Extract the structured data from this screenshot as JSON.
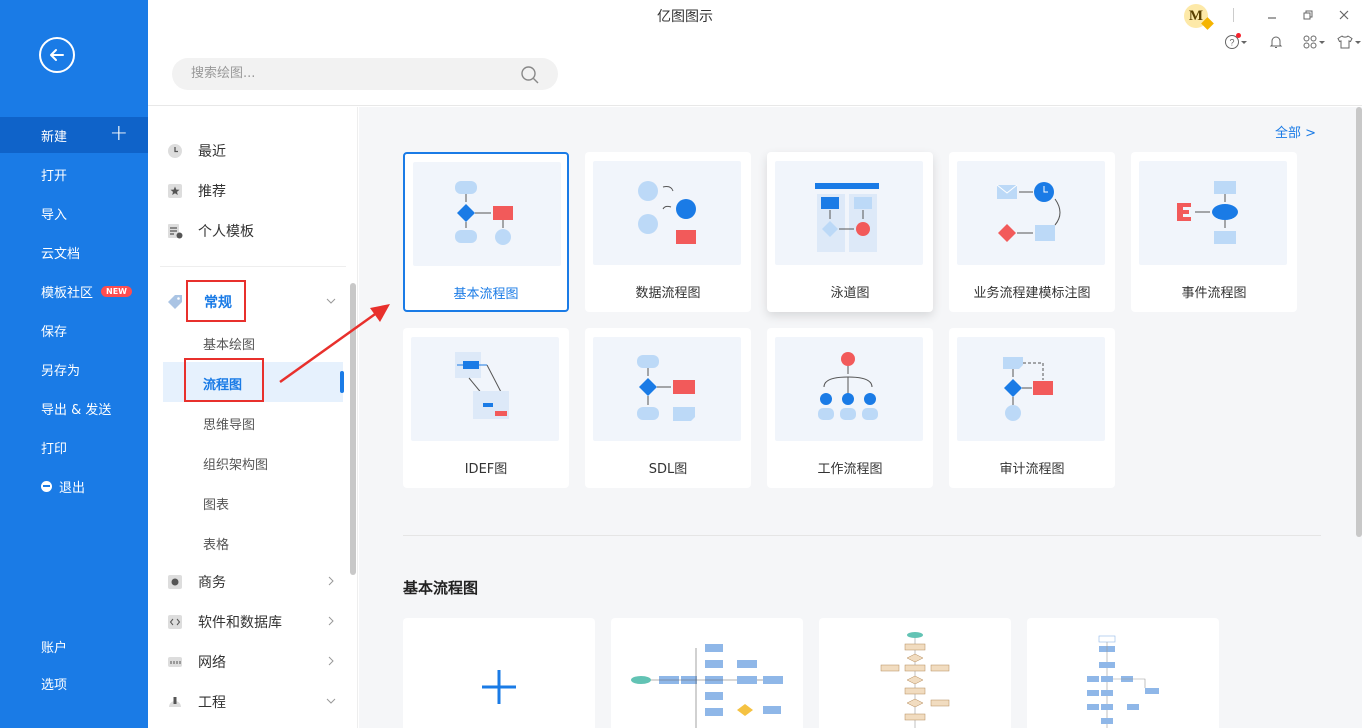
{
  "app": {
    "title": "亿图图示"
  },
  "leftnav": {
    "items": [
      {
        "label": "新建"
      },
      {
        "label": "打开"
      },
      {
        "label": "导入"
      },
      {
        "label": "云文档"
      },
      {
        "label": "模板社区",
        "badge": "NEW"
      },
      {
        "label": "保存"
      },
      {
        "label": "另存为"
      },
      {
        "label": "导出 & 发送"
      },
      {
        "label": "打印"
      },
      {
        "label": "退出"
      },
      {
        "label": "账户"
      },
      {
        "label": "选项"
      }
    ]
  },
  "header": {
    "search_placeholder": "搜索绘图...",
    "avatar_letter": "M"
  },
  "categories": {
    "top": [
      {
        "label": "最近",
        "icon": "clock-icon"
      },
      {
        "label": "推荐",
        "icon": "star-icon"
      },
      {
        "label": "个人模板",
        "icon": "template-icon"
      }
    ],
    "general": {
      "label": "常规",
      "icon": "tag-icon"
    },
    "general_subs": [
      {
        "label": "基本绘图"
      },
      {
        "label": "流程图"
      },
      {
        "label": "思维导图"
      },
      {
        "label": "组织架构图"
      },
      {
        "label": "图表"
      },
      {
        "label": "表格"
      }
    ],
    "others": [
      {
        "label": "商务",
        "icon": "business-icon"
      },
      {
        "label": "软件和数据库",
        "icon": "code-icon"
      },
      {
        "label": "网络",
        "icon": "network-icon"
      },
      {
        "label": "工程",
        "icon": "engineering-icon"
      }
    ]
  },
  "main": {
    "all_link": "全部  >",
    "cards": [
      {
        "label": "基本流程图"
      },
      {
        "label": "数据流程图"
      },
      {
        "label": "泳道图"
      },
      {
        "label": "业务流程建模标注图"
      },
      {
        "label": "事件流程图"
      },
      {
        "label": "IDEF图"
      },
      {
        "label": "SDL图"
      },
      {
        "label": "工作流程图"
      },
      {
        "label": "审计流程图"
      }
    ],
    "section_title": "基本流程图"
  },
  "colors": {
    "nav_blue": "#1a7be6",
    "accent_red": "#e8302c",
    "shape_blue": "#1a7be6",
    "shape_light": "#bcd9f7",
    "shape_red": "#f25a5a"
  }
}
